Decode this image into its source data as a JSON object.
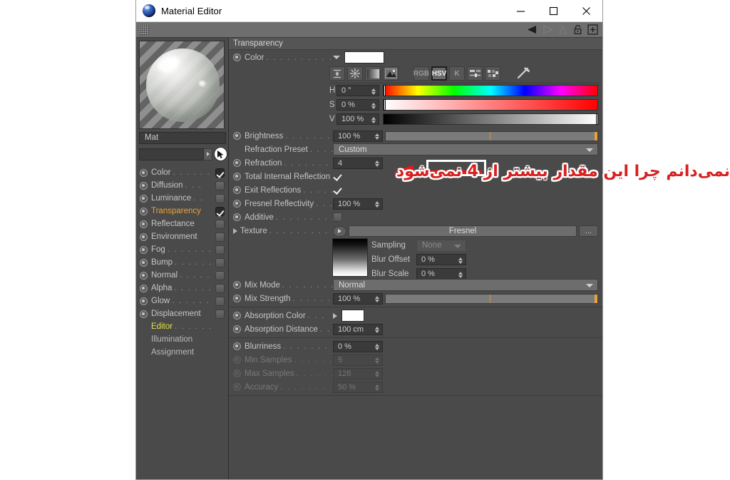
{
  "window": {
    "title": "Material Editor",
    "app_icon": "material-sphere-icon",
    "controls": {
      "minimize": "minimize-icon",
      "maximize": "maximize-icon",
      "close": "close-icon"
    }
  },
  "toolbar": {
    "grip": "drag-grip",
    "icons": [
      "play-back-icon",
      "play-forward-icon",
      "cone-icon",
      "lock-icon",
      "add-icon"
    ]
  },
  "left": {
    "preview_label": "material-preview",
    "material_name": "Mat",
    "search_value": "",
    "channels": [
      {
        "label": "Color",
        "dots": ". . . . . .",
        "checked": true,
        "state": "normal"
      },
      {
        "label": "Diffusion",
        "dots": ". . .",
        "checked": false,
        "state": "normal"
      },
      {
        "label": "Luminance",
        "dots": ". .",
        "checked": false,
        "state": "normal"
      },
      {
        "label": "Transparency",
        "dots": "",
        "checked": true,
        "state": "active"
      },
      {
        "label": "Reflectance",
        "dots": "",
        "checked": false,
        "state": "normal"
      },
      {
        "label": "Environment",
        "dots": "",
        "checked": false,
        "state": "normal"
      },
      {
        "label": "Fog",
        "dots": ". . . . . . . .",
        "checked": false,
        "state": "normal"
      },
      {
        "label": "Bump",
        "dots": ". . . . . .",
        "checked": false,
        "state": "normal"
      },
      {
        "label": "Normal",
        "dots": ". . . . .",
        "checked": false,
        "state": "normal"
      },
      {
        "label": "Alpha",
        "dots": ". . . . . .",
        "checked": false,
        "state": "normal"
      },
      {
        "label": "Glow",
        "dots": ". . . . . . .",
        "checked": false,
        "state": "normal"
      },
      {
        "label": "Displacement",
        "dots": "",
        "checked": false,
        "state": "normal"
      }
    ],
    "extra_items": [
      {
        "label": "Editor",
        "dots": ". . . . . .",
        "state": "editor"
      },
      {
        "label": "Illumination",
        "dots": "",
        "state": "plain"
      },
      {
        "label": "Assignment",
        "dots": "",
        "state": "plain"
      }
    ]
  },
  "panel": {
    "section_title": "Transparency",
    "color": {
      "label": "Color",
      "dots": ". . . . . . . . . . . .",
      "swatch_hex": "#ffffff",
      "modes": [
        {
          "name": "eyedrop-range-icon",
          "text": "",
          "selected": false
        },
        {
          "name": "color-wheel-icon",
          "text": "",
          "selected": false
        },
        {
          "name": "gradient-icon",
          "text": "",
          "selected": false
        },
        {
          "name": "image-picker-icon",
          "text": "",
          "selected": false
        },
        {
          "name": "rgb-mode-button",
          "text": "RGB",
          "selected": false
        },
        {
          "name": "hsv-mode-button",
          "text": "HSV",
          "selected": true
        },
        {
          "name": "kelvin-mode-button",
          "text": "K",
          "selected": false
        },
        {
          "name": "sliders-icon",
          "text": "",
          "selected": false
        },
        {
          "name": "swatches-icon",
          "text": "",
          "selected": false
        },
        {
          "name": "eyedropper-icon",
          "text": "",
          "selected": false
        }
      ],
      "hsv": [
        {
          "key": "H",
          "value": "0 °",
          "marker_pct": 0
        },
        {
          "key": "S",
          "value": "0 %",
          "marker_pct": 0
        },
        {
          "key": "V",
          "value": "100 %",
          "marker_pct": 100
        }
      ]
    },
    "rows": [
      {
        "name": "brightness",
        "label": "Brightness",
        "dots": ". . . . . . . . . .",
        "type": "number-slider",
        "value": "100 %"
      },
      {
        "name": "refraction-preset",
        "label": "Refraction Preset",
        "dots": ". . . . . .",
        "type": "dropdown",
        "value": "Custom",
        "no_radio": true
      },
      {
        "name": "refraction",
        "label": "Refraction",
        "dots": ". . . . . . . . . .",
        "type": "number",
        "value": "4",
        "highlighted": true
      },
      {
        "name": "total-internal-reflection",
        "label": "Total Internal Reflection",
        "dots": "",
        "type": "checkbox",
        "value": true
      },
      {
        "name": "exit-reflections",
        "label": "Exit Reflections",
        "dots": ". . . . . . .",
        "type": "checkbox",
        "value": true
      },
      {
        "name": "fresnel-reflectivity",
        "label": "Fresnel Reflectivity",
        "dots": ". . . .",
        "type": "number",
        "value": "100 %"
      },
      {
        "name": "additive",
        "label": "Additive",
        "dots": ". . . . . . . . . . .",
        "type": "checkbox",
        "value": false
      }
    ],
    "texture": {
      "label": "Texture",
      "dots": ". . . . . . . . . . . . .",
      "value": "Fresnel",
      "more_button": "...",
      "sampling_label": "Sampling",
      "sampling_value": "None",
      "blur_offset_label": "Blur Offset",
      "blur_offset_value": "0 %",
      "blur_scale_label": "Blur Scale",
      "blur_scale_value": "0 %"
    },
    "mix": [
      {
        "name": "mix-mode",
        "label": "Mix Mode",
        "dots": ". . . . . . . . . . .",
        "type": "dropdown",
        "value": "Normal"
      },
      {
        "name": "mix-strength",
        "label": "Mix Strength",
        "dots": ". . . . . . . . .",
        "type": "number-slider",
        "value": "100 %"
      }
    ],
    "absorption": [
      {
        "name": "absorption-color",
        "label": "Absorption Color",
        "dots": ". . .",
        "type": "swatch",
        "value": "#ffffff"
      },
      {
        "name": "absorption-distance",
        "label": "Absorption Distance",
        "dots": ". . .",
        "type": "number",
        "value": "100 cm"
      }
    ],
    "blur": [
      {
        "name": "blurriness",
        "label": "Blurriness",
        "dots": ". . . . . . . . . . .",
        "type": "number",
        "value": "0 %",
        "dim": false
      },
      {
        "name": "min-samples",
        "label": "Min Samples",
        "dots": ". . . . . . . . .",
        "type": "number",
        "value": "5",
        "dim": true
      },
      {
        "name": "max-samples",
        "label": "Max Samples",
        "dots": ". . . . . . . . .",
        "type": "number",
        "value": "128",
        "dim": true
      },
      {
        "name": "accuracy",
        "label": "Accuracy",
        "dots": ". . . . . . . . . . .",
        "type": "number",
        "value": "50 %",
        "dim": true
      }
    ]
  },
  "annotation": {
    "text": "نمی‌دانم چرا این مقدار بیشتر از 4 نمی‌شود",
    "color": "#d92020",
    "arrow": "left-arrow-annotation"
  }
}
